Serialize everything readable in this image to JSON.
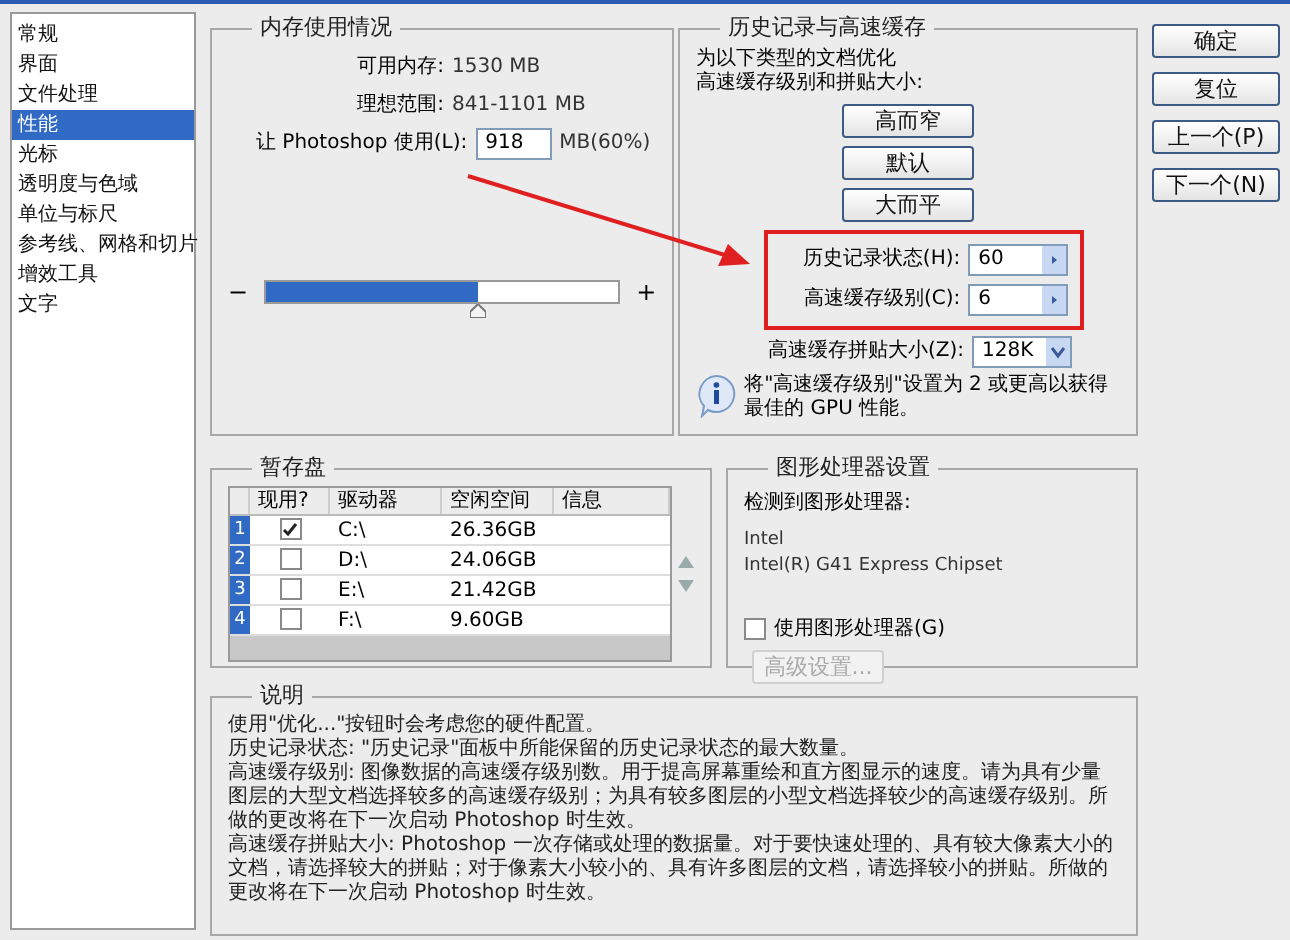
{
  "sidebar": {
    "items": [
      {
        "label": "常规",
        "selected": false
      },
      {
        "label": "界面",
        "selected": false
      },
      {
        "label": "文件处理",
        "selected": false
      },
      {
        "label": "性能",
        "selected": true
      },
      {
        "label": "光标",
        "selected": false
      },
      {
        "label": "透明度与色域",
        "selected": false
      },
      {
        "label": "单位与标尺",
        "selected": false
      },
      {
        "label": "参考线、网格和切片",
        "selected": false
      },
      {
        "label": "增效工具",
        "selected": false
      },
      {
        "label": "文字",
        "selected": false
      }
    ]
  },
  "memory": {
    "title": "内存使用情况",
    "stats": [
      {
        "label": "可用内存:",
        "value": "1530 MB"
      },
      {
        "label": "理想范围:",
        "value": "841-1101 MB"
      }
    ],
    "use_label": "让 Photoshop 使用(L):",
    "use_value": "918",
    "use_unit": "MB(60%)",
    "minus": "−",
    "plus": "+",
    "level": 0.6
  },
  "history": {
    "title": "历史记录与高速缓存",
    "intro": [
      "为以下类型的文档优化",
      "高速缓存级别和拼贴大小:"
    ],
    "presets": [
      "高而窄",
      "默认",
      "大而平"
    ],
    "fields": [
      {
        "label": "历史记录状态(H):",
        "value": "60"
      },
      {
        "label": "高速缓存级别(C):",
        "value": "6"
      }
    ],
    "tile_label": "高速缓存拼贴大小(Z):",
    "tile_value": "128K",
    "info": "将\"高速缓存级别\"设置为 2 或更高以获得最佳的 GPU 性能。"
  },
  "buttons": [
    "确定",
    "复位",
    "上一个(P)",
    "下一个(N)"
  ],
  "scratch": {
    "title": "暂存盘",
    "columns": [
      "现用?",
      "驱动器",
      "空闲空间",
      "信息"
    ],
    "rows": [
      {
        "index": "1",
        "checked": true,
        "drive": "C:\\",
        "free": "26.36GB"
      },
      {
        "index": "2",
        "checked": false,
        "drive": "D:\\",
        "free": "24.06GB"
      },
      {
        "index": "3",
        "checked": false,
        "drive": "E:\\",
        "free": "21.42GB"
      },
      {
        "index": "4",
        "checked": false,
        "drive": "F:\\",
        "free": "9.60GB"
      }
    ]
  },
  "gpu": {
    "title": "图形处理器设置",
    "detected": "检测到图形处理器:",
    "vendor": "Intel",
    "model": "Intel(R) G41 Express Chipset",
    "use_label": "使用图形处理器(G)",
    "use_checked": false,
    "advanced": "高级设置...",
    "advanced_disabled": true
  },
  "description": {
    "title": "说明",
    "paragraphs": [
      "使用\"优化...\"按钮时会考虑您的硬件配置。",
      "历史记录状态: \"历史记录\"面板中所能保留的历史记录状态的最大数量。",
      "高速缓存级别: 图像数据的高速缓存级别数。用于提高屏幕重绘和直方图显示的速度。请为具有少量图层的大型文档选择较多的高速缓存级别；为具有较多图层的小型文档选择较少的高速缓存级别。所做的更改将在下一次启动 Photoshop 时生效。",
      "高速缓存拼贴大小: Photoshop 一次存储或处理的数据量。对于要快速处理的、具有较大像素大小的文档，请选择较大的拼贴；对于像素大小较小的、具有许多图层的文档，请选择较小的拼贴。所做的更改将在下一次启动 Photoshop 时生效。"
    ]
  }
}
